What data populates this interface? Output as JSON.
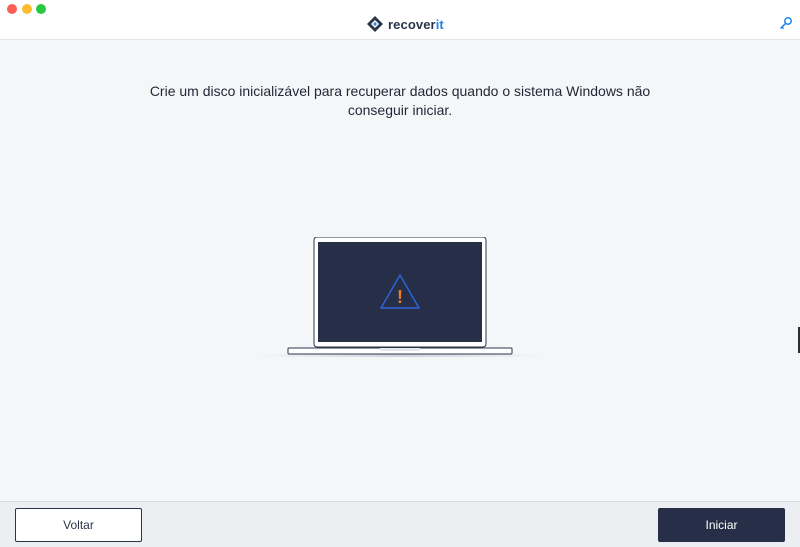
{
  "app": {
    "brand_prefix": "recover",
    "brand_suffix": "it",
    "icons": {
      "window_close": "traffic-light-close",
      "window_minimize": "traffic-light-minimize",
      "window_maximize": "traffic-light-maximize",
      "logo": "recoverit-logo",
      "license": "key-icon"
    }
  },
  "main": {
    "headline_line1": "Crie um disco inicializável para recuperar dados quando o sistema Windows não",
    "headline_line2": "conseguir iniciar.",
    "illustration": {
      "icon": "warning-triangle",
      "symbol": "!"
    }
  },
  "footer": {
    "back_label": "Voltar",
    "start_label": "Iniciar"
  },
  "colors": {
    "accent": "#1d84e8",
    "primary_button": "#262f47",
    "screen": "#262f47",
    "warning_orange": "#f07a2c",
    "warning_outline": "#2f66e0"
  }
}
